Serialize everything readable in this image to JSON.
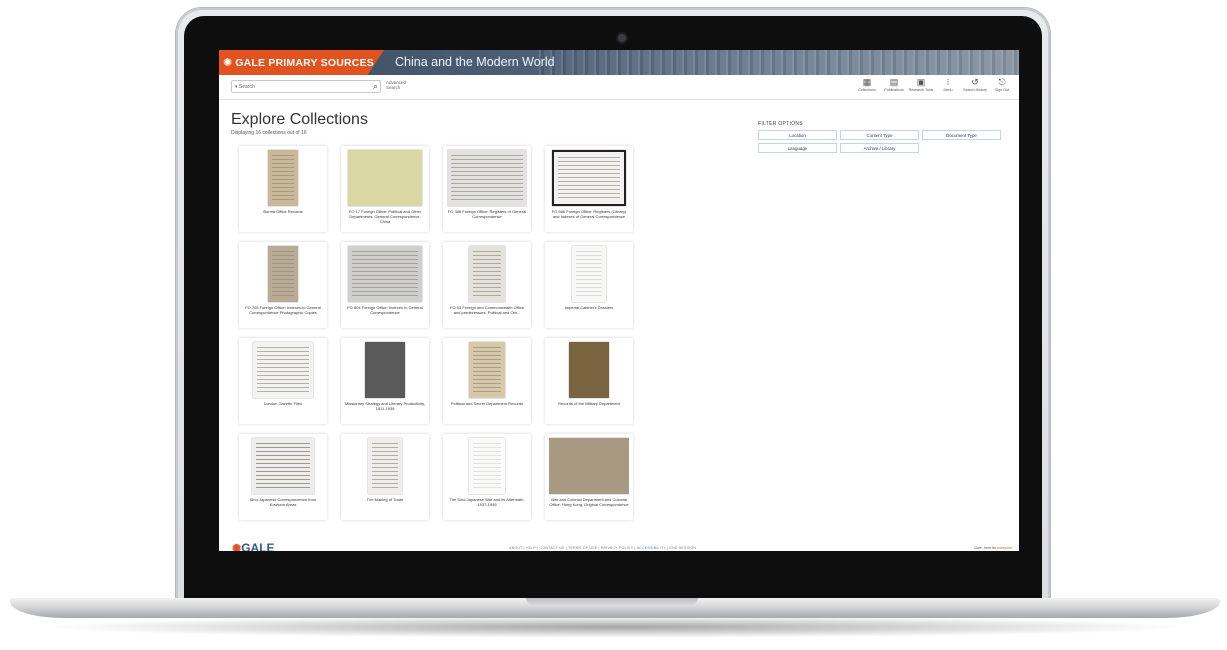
{
  "brand": {
    "logo_icon": "gale-burst-icon",
    "name": "GALE PRIMARY SOURCES",
    "accent": "#e0531f"
  },
  "collection_title": "China and the Modern World",
  "search": {
    "type_label": "▾ Search",
    "placeholder": "",
    "advanced_label": "Advanced Search"
  },
  "tools": [
    {
      "icon": "collections-icon",
      "label": "Collections"
    },
    {
      "icon": "publications-icon",
      "label": "Publications"
    },
    {
      "icon": "research-tools-icon",
      "label": "Research Tools"
    },
    {
      "icon": "menu-icon",
      "label": "Menu"
    },
    {
      "icon": "search-history-icon",
      "label": "Search History"
    },
    {
      "icon": "sign-out-icon",
      "label": "Sign Out"
    }
  ],
  "page": {
    "title": "Explore Collections",
    "subtitle": "Displaying 16 collections out of 16"
  },
  "cards": [
    {
      "label": "Burma Office Records"
    },
    {
      "label": "FO 17 Foreign Office: Political and Other Departments: General Correspondence, China"
    },
    {
      "label": "FO 366 Foreign Office: Registers of General Correspondence"
    },
    {
      "label": "FO 566 Foreign Office: Registers (Library) and Indexes of General Correspondence"
    },
    {
      "label": "FO 705 Foreign Office: Indexes to General Correspondence Photographic Copies"
    },
    {
      "label": "FO 804 Foreign Office: Indexes to General Correspondence"
    },
    {
      "label": "FO 93 Foreign and Commonwealth Office and predecessors: Political and Oth..."
    },
    {
      "label": "Imperial Cabinet's Dossiers"
    },
    {
      "label": "London Gazette Files"
    },
    {
      "label": "Missionary Strategy and Literary Productivity, 1811-1939"
    },
    {
      "label": "Political and Secret Department Records"
    },
    {
      "label": "Records of the Military Department"
    },
    {
      "label": "Sino-Japanese Correspondence from Kowloon Areas"
    },
    {
      "label": "The Making of Trade"
    },
    {
      "label": "The Sino-Japanese War and its Aftermath, 1937-1945"
    },
    {
      "label": "War and Colonial Department and Colonial Office: Hong Kong, Original Correspondence"
    }
  ],
  "filter": {
    "title": "FILTER OPTIONS",
    "row1": [
      "Location",
      "Content Type",
      "Document Type"
    ],
    "row2": [
      "Language",
      "Archive / Library"
    ]
  },
  "footer": {
    "logo_text": "GALE",
    "links": "ABOUT | HELP | CONTACT US | TERMS OF USE | PRIVACY POLICY | ACCESSIBILITY | END SESSION",
    "right_text": "Gale, here for ",
    "right_link": "everyone."
  }
}
